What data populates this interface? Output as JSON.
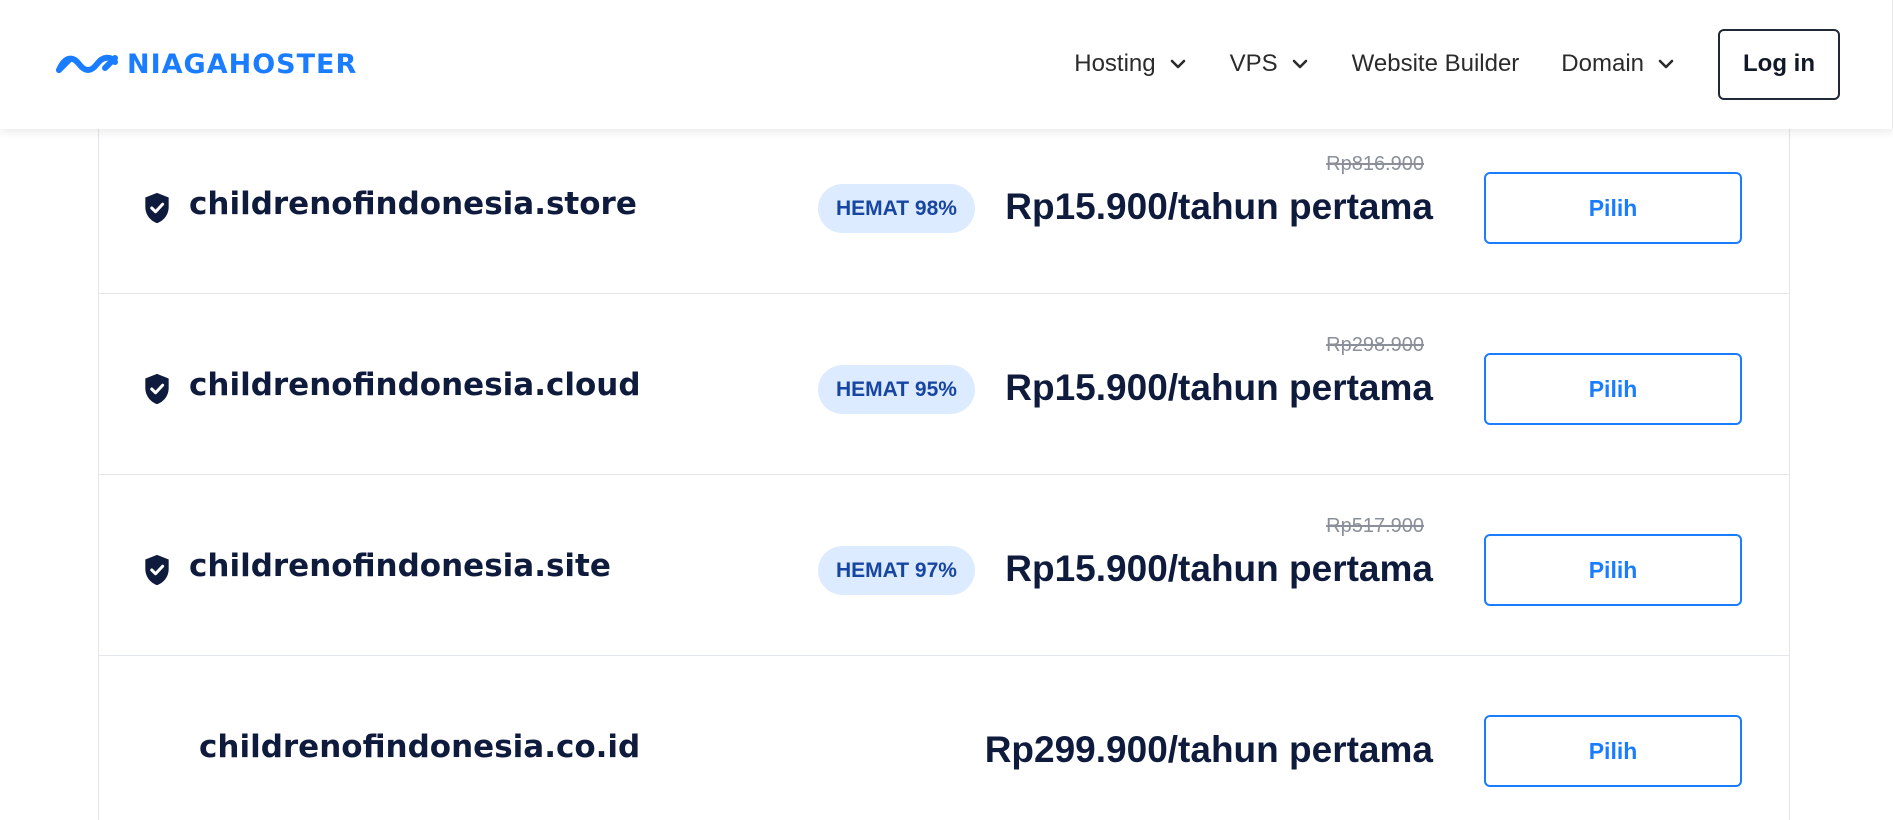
{
  "brand": {
    "name": "NIAGAHOSTER",
    "color": "#1a7cff"
  },
  "nav": {
    "items": [
      {
        "label": "Hosting",
        "has_dropdown": true
      },
      {
        "label": "VPS",
        "has_dropdown": true
      },
      {
        "label": "Website Builder",
        "has_dropdown": false
      },
      {
        "label": "Domain",
        "has_dropdown": true
      }
    ],
    "login_label": "Log in"
  },
  "domains": [
    {
      "name": "childrenofindonesia.store",
      "badge": "HEMAT 98%",
      "old_price": "Rp816.900",
      "price": "Rp15.900/tahun pertama",
      "button": "Pilih",
      "verified_icon": "shield-check-icon"
    },
    {
      "name": "childrenofindonesia.cloud",
      "badge": "HEMAT 95%",
      "old_price": "Rp298.900",
      "price": "Rp15.900/tahun pertama",
      "button": "Pilih",
      "verified_icon": "shield-check-icon"
    },
    {
      "name": "childrenofindonesia.site",
      "badge": "HEMAT 97%",
      "old_price": "Rp517.900",
      "price": "Rp15.900/tahun pertama",
      "button": "Pilih",
      "verified_icon": "shield-check-icon"
    },
    {
      "name": "childrenofindonesia.co.id",
      "badge": "",
      "old_price": "",
      "price": "Rp299.900/tahun pertama",
      "button": "Pilih",
      "verified_icon": ""
    }
  ],
  "colors": {
    "accent": "#1a7cff",
    "badge_bg": "#dcebff",
    "badge_text": "#1746a2",
    "text_dark": "#0f1b3d"
  }
}
